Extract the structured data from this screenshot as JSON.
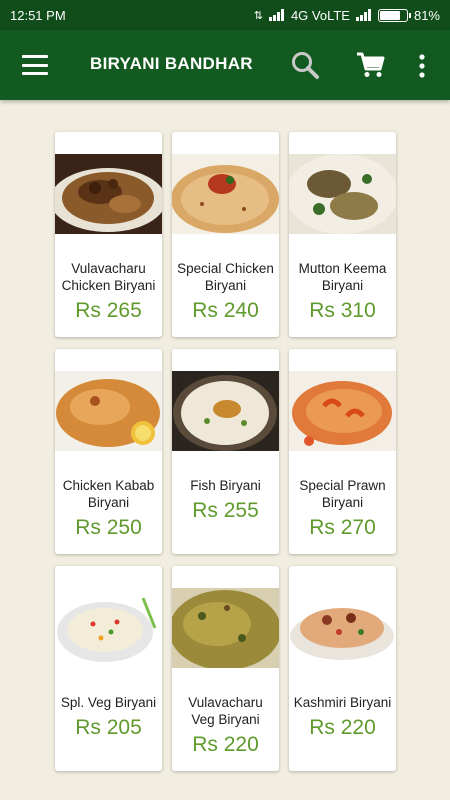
{
  "status_bar": {
    "time": "12:51 PM",
    "network": "4G VoLTE",
    "battery": "81%",
    "battery_level": 0.81
  },
  "app_bar": {
    "title": "BIRYANI BANDHAR",
    "menu_icon": "hamburger-menu-icon",
    "search_icon": "search-icon",
    "cart_icon": "shopping-cart-icon",
    "more_icon": "more-vertical-icon"
  },
  "colors": {
    "app_bar": "#125a1f",
    "status_bar": "#114d1b",
    "price": "#5f9a2d",
    "background": "#f1ede0"
  },
  "menu_items": [
    {
      "line1": "Vulavacharu",
      "line2": "Chicken Biryani",
      "price": "Rs 265"
    },
    {
      "line1": "Special Chicken",
      "line2": "Biryani",
      "price": "Rs 240"
    },
    {
      "line1": "Mutton Keema",
      "line2": "Biryani",
      "price": "Rs 310"
    },
    {
      "line1": "Chicken Kabab",
      "line2": "Biryani",
      "price": "Rs 250"
    },
    {
      "line1": "Fish Biryani",
      "line2": "",
      "price": "Rs 255"
    },
    {
      "line1": "Special Prawn",
      "line2": "Biryani",
      "price": "Rs 270"
    },
    {
      "line1": "Spl. Veg Biryani",
      "line2": "",
      "price": "Rs 205"
    },
    {
      "line1": "Vulavacharu",
      "line2": "Veg Biryani",
      "price": "Rs 220"
    },
    {
      "line1": "Kashmiri Biryani",
      "line2": "",
      "price": "Rs 220"
    }
  ]
}
